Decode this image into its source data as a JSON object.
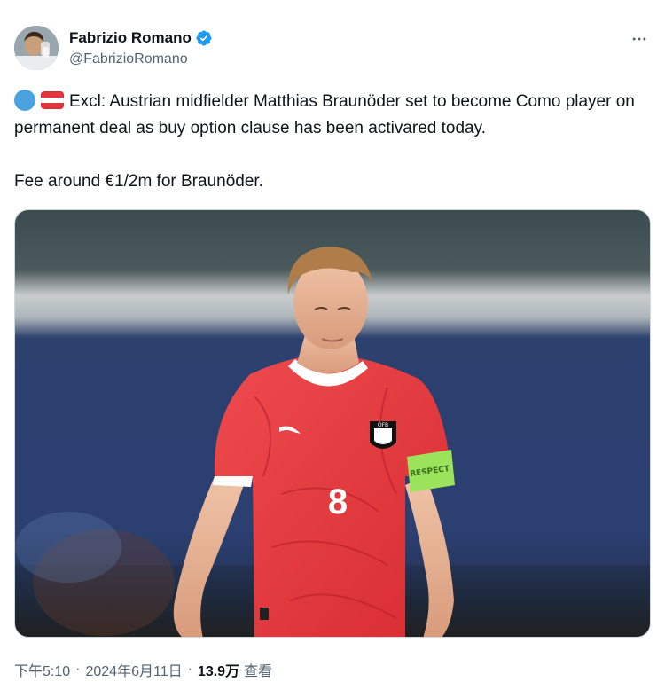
{
  "author": {
    "display_name": "Fabrizio Romano",
    "handle": "@FabrizioRomano",
    "verified": true,
    "verified_color": "#1d9bf0"
  },
  "tweet": {
    "emoji": [
      "blue-circle-emoji",
      "austria-flag-emoji"
    ],
    "line1": "Excl: Austrian midfielder Matthias Braunöder set to become Como player on permanent deal as buy option clause has been activared today.",
    "line2": "Fee around €1/2m for Braunöder."
  },
  "media": {
    "shirt_number": "8",
    "armband_text": "RESPECT",
    "crest_text": "ÖFB",
    "colors": {
      "kit_red": "#e2363c",
      "armband": "#9be35a"
    }
  },
  "meta": {
    "time": "下午5:10",
    "separator": "·",
    "date": "2024年6月11日",
    "views_count": "13.9万",
    "views_label": "查看"
  },
  "more_icon": "more-horizontal-icon"
}
